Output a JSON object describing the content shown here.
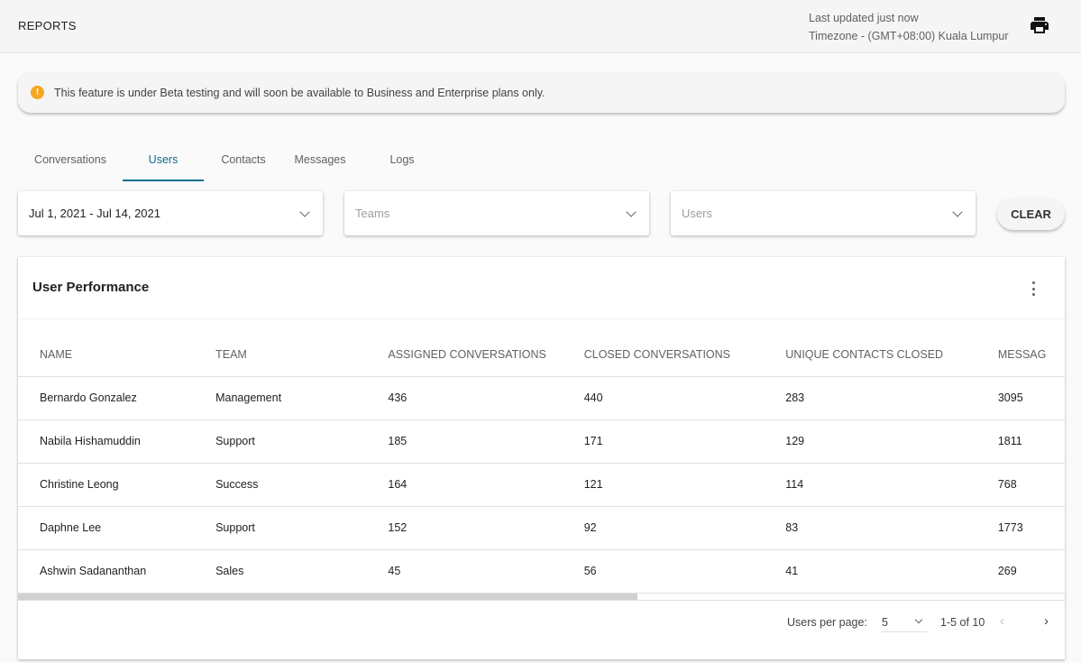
{
  "header": {
    "title": "REPORTS",
    "last_updated": "Last updated just now",
    "timezone": "Timezone - (GMT+08:00) Kuala Lumpur"
  },
  "alert": {
    "text": "This feature is under Beta testing and will soon be available to Business and Enterprise plans only."
  },
  "tabs": [
    {
      "label": "Conversations"
    },
    {
      "label": "Users",
      "active": true
    },
    {
      "label": "Contacts"
    },
    {
      "label": "Messages"
    },
    {
      "label": "Logs"
    }
  ],
  "filters": {
    "date_range": "Jul 1, 2021 - Jul 14, 2021",
    "teams_placeholder": "Teams",
    "users_placeholder": "Users",
    "clear_label": "CLEAR"
  },
  "card": {
    "title": "User Performance",
    "columns": [
      "NAME",
      "TEAM",
      "ASSIGNED CONVERSATIONS",
      "CLOSED CONVERSATIONS",
      "UNIQUE CONTACTS CLOSED",
      "MESSAG"
    ],
    "rows": [
      [
        "Bernardo Gonzalez",
        "Management",
        "436",
        "440",
        "283",
        "3095"
      ],
      [
        "Nabila Hishamuddin",
        "Support",
        "185",
        "171",
        "129",
        "1811"
      ],
      [
        "Christine Leong",
        "Success",
        "164",
        "121",
        "114",
        "768"
      ],
      [
        "Daphne Lee",
        "Support",
        "152",
        "92",
        "83",
        "1773"
      ],
      [
        "Ashwin Sadananthan",
        "Sales",
        "45",
        "56",
        "41",
        "269"
      ]
    ]
  },
  "pagination": {
    "per_page_label": "Users per page:",
    "per_page": "5",
    "range": "1-5 of 10"
  },
  "colors": {
    "accent": "#0f6d8f",
    "warning": "#f5a623"
  }
}
